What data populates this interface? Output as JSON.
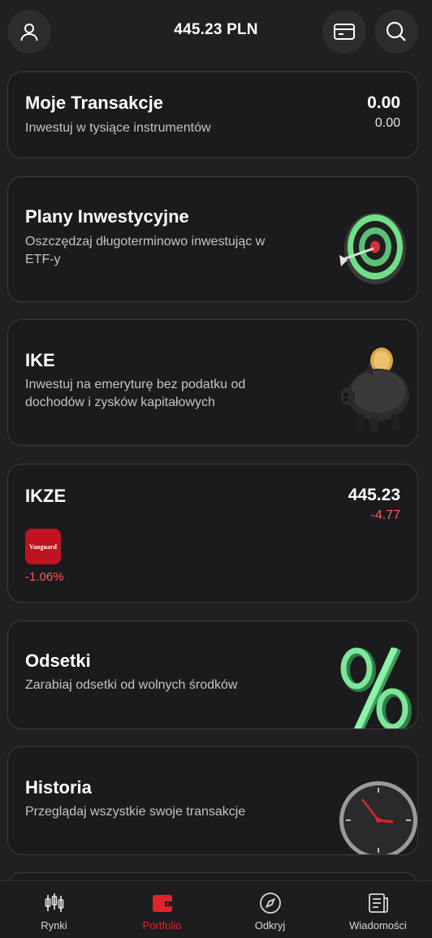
{
  "header": {
    "balance": "445.23 PLN",
    "profile_icon": "user-icon",
    "card_icon": "credit-card-icon",
    "search_icon": "search-icon"
  },
  "cards": {
    "transactions": {
      "title": "Moje Transakcje",
      "subtitle": "Inwestuj w tysiące instrumentów",
      "value": "0.00",
      "change": "0.00"
    },
    "plans": {
      "title": "Plany Inwestycyjne",
      "subtitle_line1": "Oszczędzaj długoterminowo inwestując w",
      "subtitle_line2": "ETF-y",
      "image": "target-icon"
    },
    "ike": {
      "title": "IKE",
      "subtitle_line1": "Inwestuj na emeryturę bez podatku od",
      "subtitle_line2": "dochodów i zysków kapitałowych",
      "image": "piggy-bank-icon"
    },
    "ikze": {
      "title": "IKZE",
      "value": "445.23",
      "change": "-4.77",
      "holding_logo": "Vanguard",
      "holding_change": "-1.06%"
    },
    "interest": {
      "title": "Odsetki",
      "subtitle": "Zarabiaj odsetki od wolnych środków",
      "image": "percent-icon"
    },
    "history": {
      "title": "Historia",
      "subtitle": "Przeglądaj wszystkie swoje transakcje",
      "image": "clock-icon"
    }
  },
  "nav": {
    "items": [
      {
        "label": "Rynki",
        "icon": "candlestick-icon"
      },
      {
        "label": "Portfolio",
        "icon": "wallet-icon"
      },
      {
        "label": "Odkryj",
        "icon": "compass-icon"
      },
      {
        "label": "Wiadomości",
        "icon": "news-icon"
      }
    ]
  },
  "colors": {
    "accent": "#e2232d",
    "negative": "#ff5a5f",
    "background": "#202022",
    "card": "#1b1b1d"
  }
}
